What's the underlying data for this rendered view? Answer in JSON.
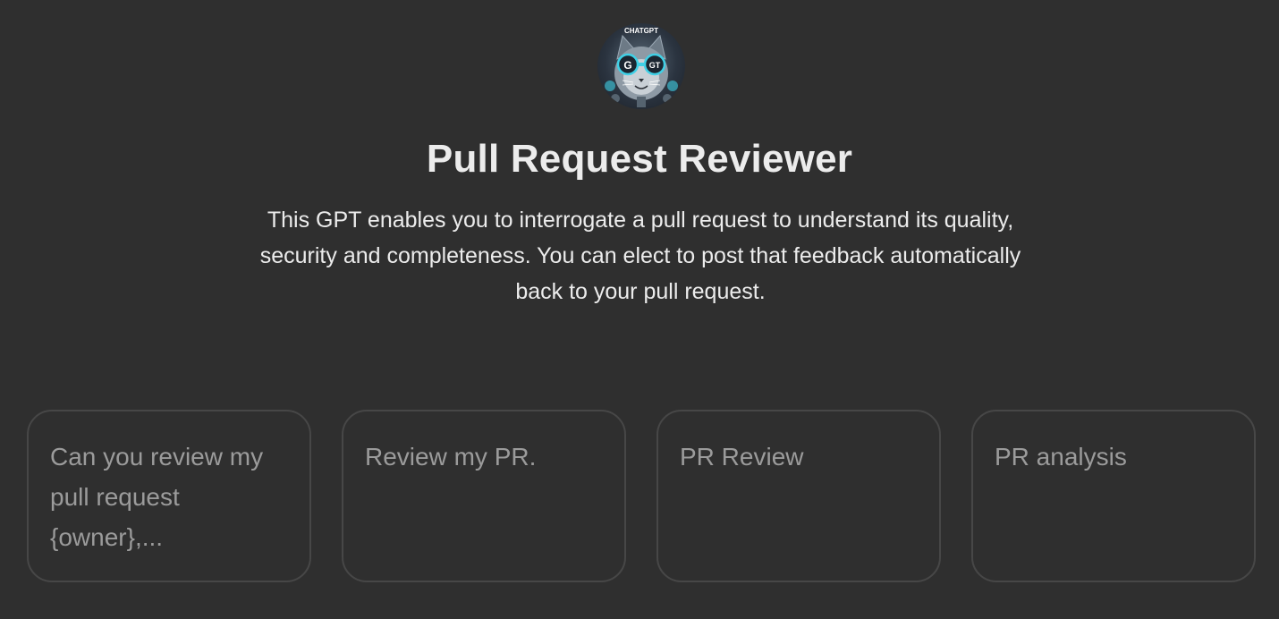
{
  "gpt": {
    "avatar_icon": "cat-robot-avatar-icon",
    "avatar_text": "CHATGPT",
    "avatar_glasses_left": "G",
    "avatar_glasses_right": "GT",
    "name": "Pull Request Reviewer",
    "description": "This GPT enables you to interrogate a pull request to understand its quality, security and completeness. You can elect to post that feedback automatically back to your pull request."
  },
  "starters": [
    {
      "label": "Can you review my pull request {owner},..."
    },
    {
      "label": "Review my PR."
    },
    {
      "label": "PR Review"
    },
    {
      "label": "PR analysis"
    }
  ],
  "colors": {
    "background": "#2f2f2f",
    "title_text": "#ececec",
    "starter_text": "#9b9b9b",
    "starter_border": "#474747"
  }
}
